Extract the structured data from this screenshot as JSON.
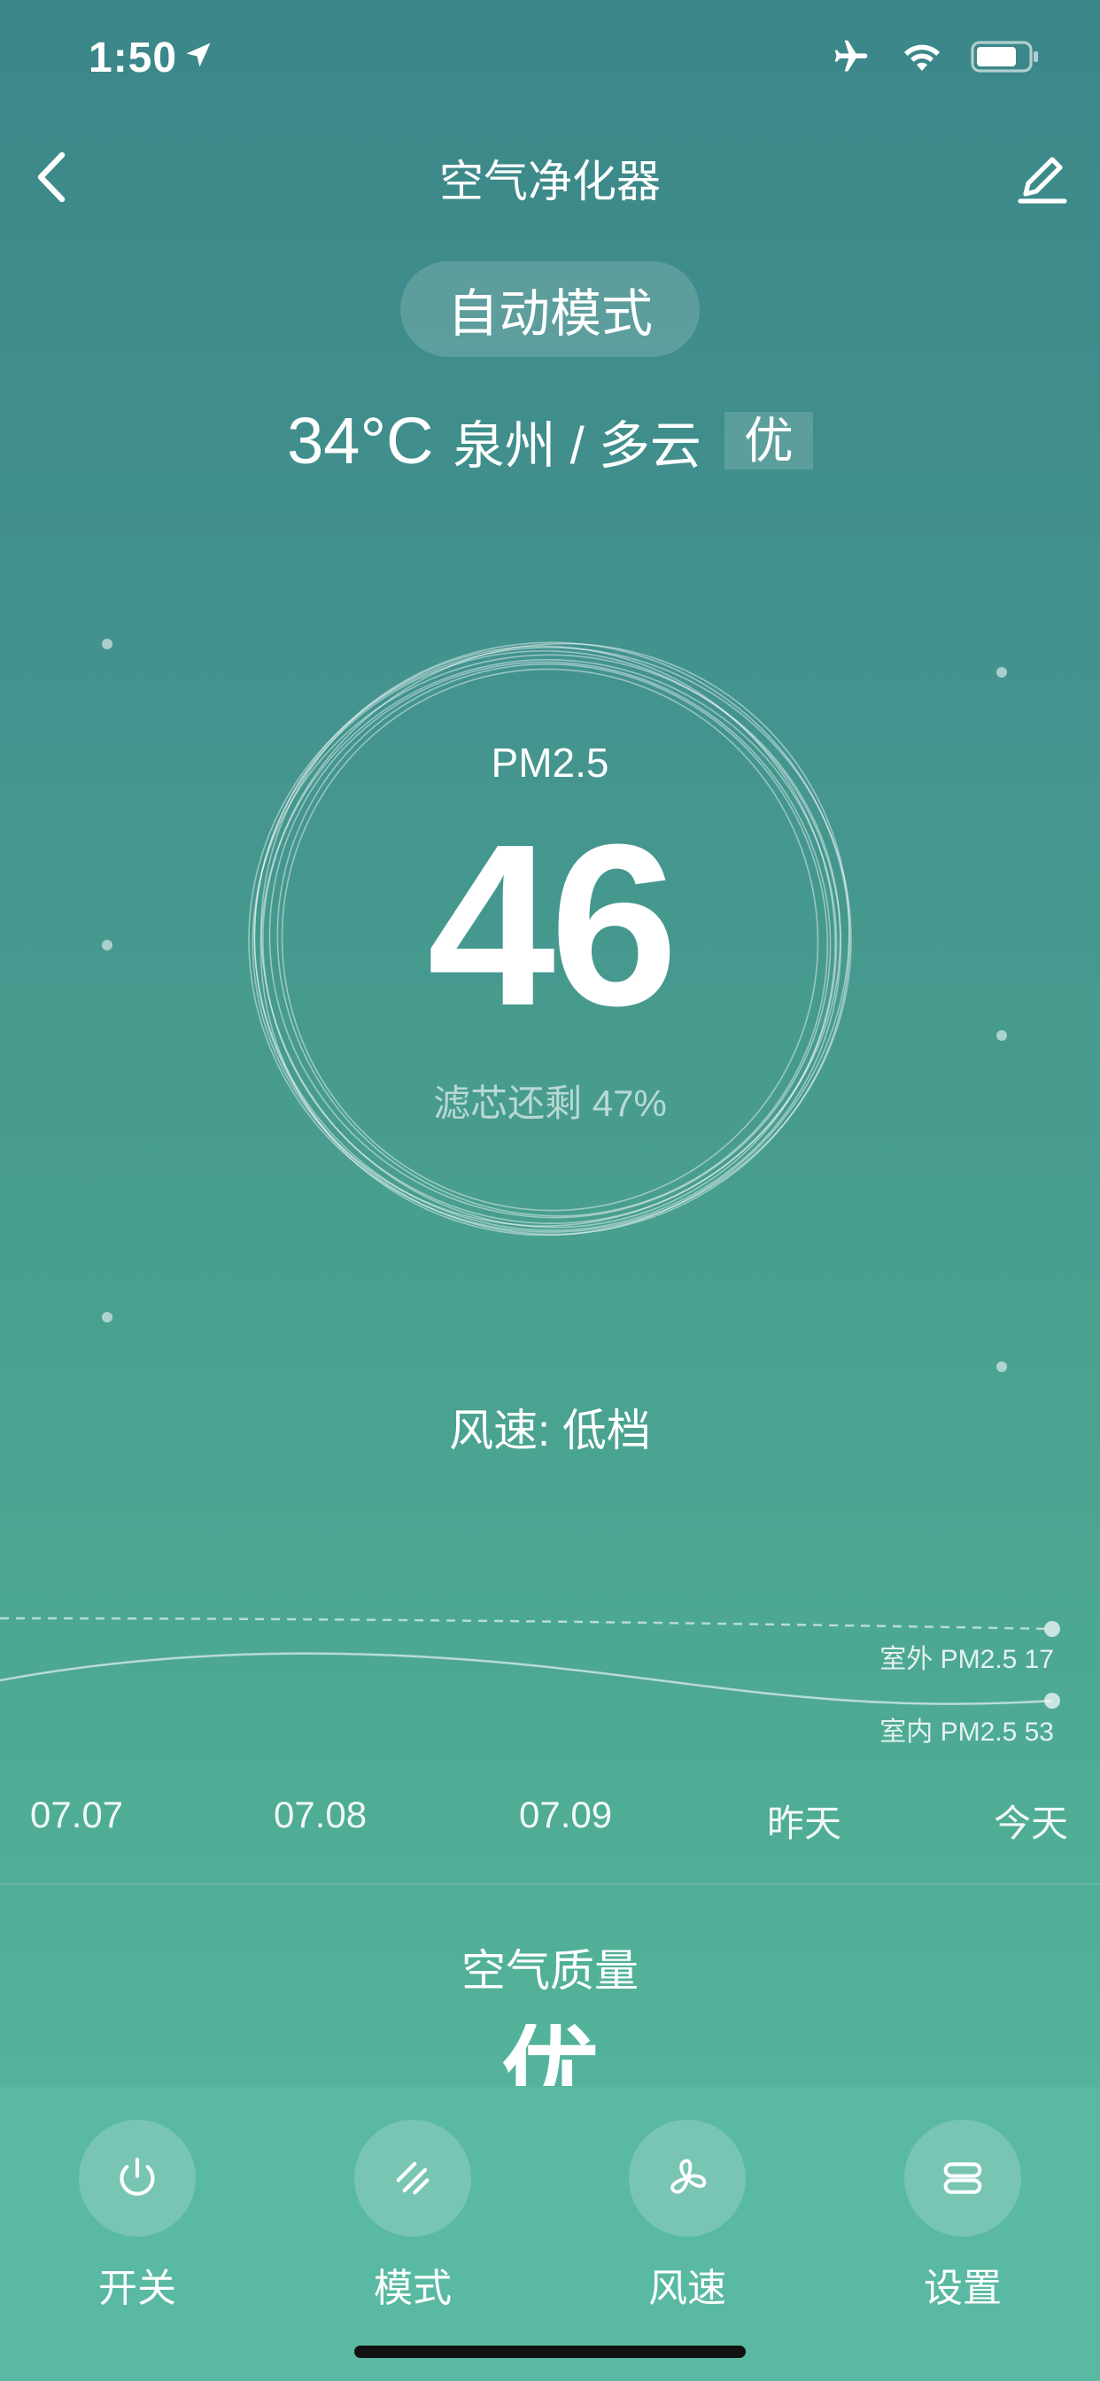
{
  "status_bar": {
    "time": "1:50"
  },
  "nav": {
    "title": "空气净化器"
  },
  "mode": {
    "label": "自动模式"
  },
  "weather": {
    "temp": "34°C",
    "location": "泉州 / 多云",
    "quality": "优"
  },
  "pm25": {
    "label": "PM2.5",
    "value": "46",
    "filter_text": "滤芯还剩 47%"
  },
  "fan": {
    "text": "风速: 低档"
  },
  "trend": {
    "outdoor_label": "室外 PM2.5 17",
    "indoor_label": "室内 PM2.5 53",
    "dates": [
      "07.07",
      "07.08",
      "07.09",
      "昨天",
      "今天"
    ]
  },
  "air_quality": {
    "title": "空气质量",
    "value": "优"
  },
  "controls": [
    {
      "label": "开关",
      "icon": "power-icon"
    },
    {
      "label": "模式",
      "icon": "mode-icon"
    },
    {
      "label": "风速",
      "icon": "fan-icon"
    },
    {
      "label": "设置",
      "icon": "settings-icon"
    }
  ]
}
